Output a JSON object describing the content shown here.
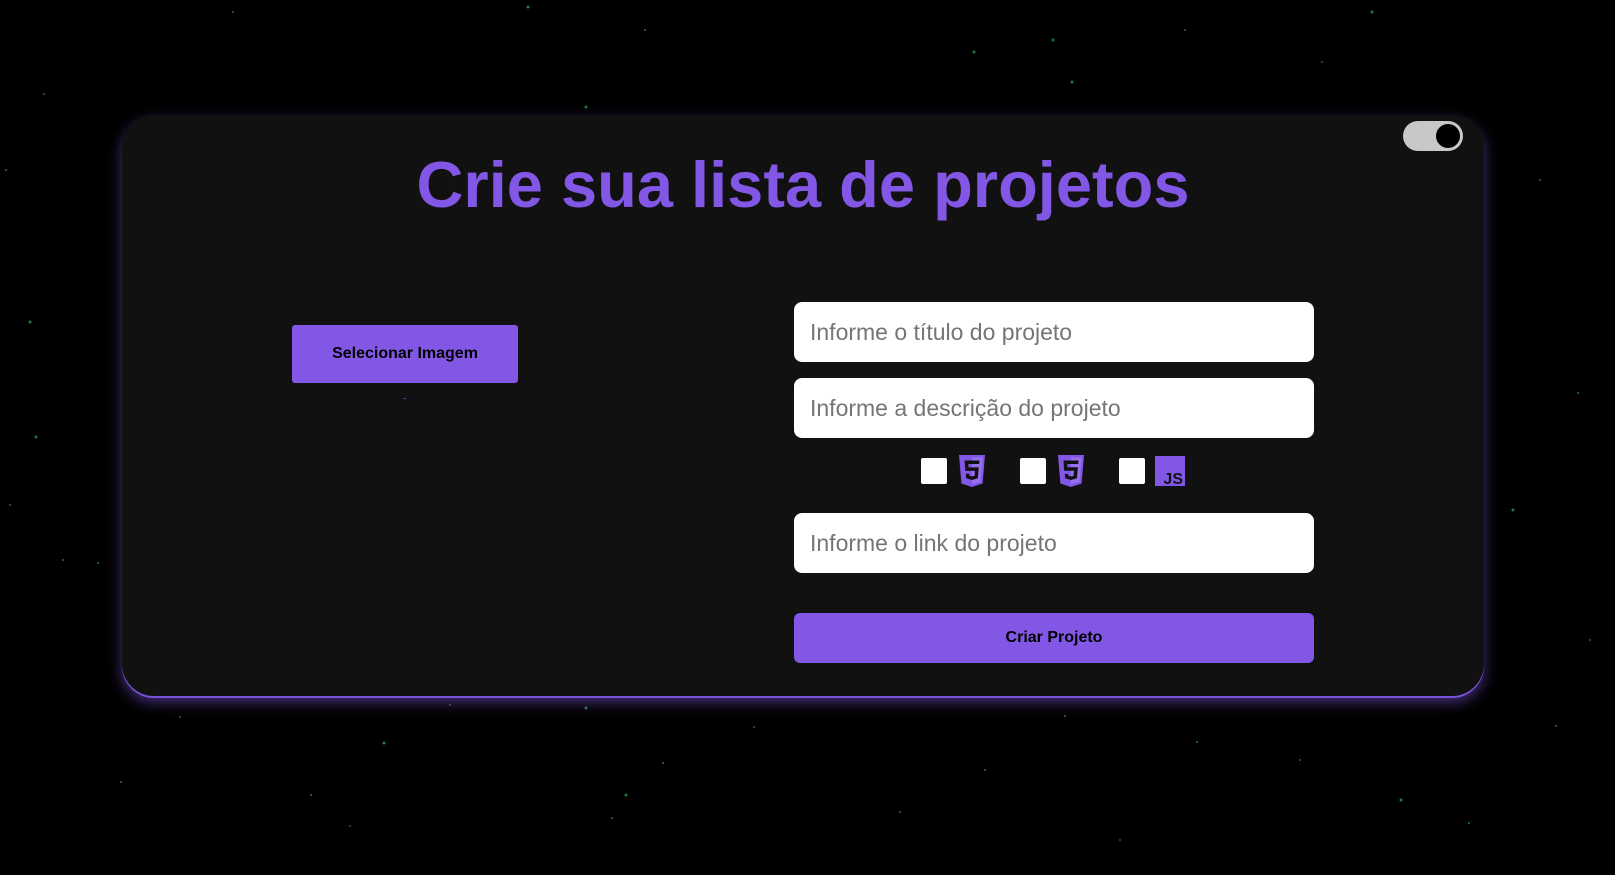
{
  "page": {
    "title": "Crie sua lista de projetos"
  },
  "theme": {
    "accent": "#8257e5",
    "card_background": "#111111",
    "page_background": "#000000",
    "toggle_track": "#c8c8c8"
  },
  "theme_toggle": {
    "icon": "toggle-switch-icon",
    "state": "on"
  },
  "image_picker": {
    "button_label": "Selecionar Imagem"
  },
  "form": {
    "title_placeholder": "Informe o título do projeto",
    "description_placeholder": "Informe a descrição do projeto",
    "link_placeholder": "Informe o link do projeto",
    "technologies": [
      {
        "icon": "html5-icon",
        "checked": false
      },
      {
        "icon": "css3-icon",
        "checked": false
      },
      {
        "icon": "javascript-icon",
        "checked": false
      }
    ],
    "submit_label": "Criar Projeto"
  }
}
